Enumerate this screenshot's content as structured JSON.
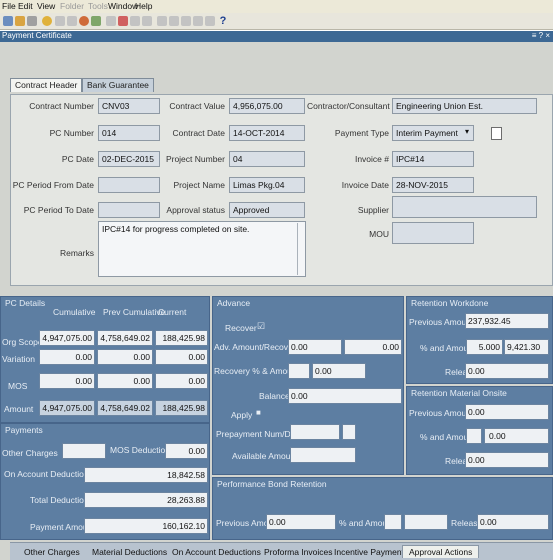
{
  "menu": [
    "File",
    "Edit",
    "View",
    "Folder",
    "Tools",
    "Window",
    "Help"
  ],
  "window": {
    "title": "Payment Certificate",
    "controls": "≡ ? ×"
  },
  "tabs": [
    "Contract Header",
    "Bank Guarantee"
  ],
  "header": {
    "contract_number_label": "Contract Number",
    "contract_number": "CNV03",
    "pc_number_label": "PC Number",
    "pc_number": "014",
    "pc_date_label": "PC Date",
    "pc_date": "02-DEC-2015",
    "pc_period_from_label": "PC Period From Date",
    "pc_period_from": "",
    "pc_period_to_label": "PC Period To Date",
    "pc_period_to": "",
    "contract_value_label": "Contract Value",
    "contract_value": "4,956,075.00",
    "contract_date_label": "Contract Date",
    "contract_date": "14-OCT-2014",
    "project_number_label": "Project Number",
    "project_number": "04",
    "project_name_label": "Project Name",
    "project_name": "Limas Pkg.04",
    "approval_status_label": "Approval status",
    "approval_status": "Approved",
    "contractor_label": "Contractor/Consultant",
    "contractor": "Engineering Union Est.",
    "payment_type_label": "Payment Type",
    "payment_type": "Interim Payment",
    "invoice_no_label": "Invoice #",
    "invoice_no": "IPC#14",
    "invoice_date_label": "Invoice Date",
    "invoice_date": "28-NOV-2015",
    "supplier_label": "Supplier",
    "supplier": "",
    "mou_label": "MOU",
    "mou": "",
    "remarks_label": "Remarks",
    "remarks": "IPC#14 for progress completed on site."
  },
  "pc_details": {
    "title": "PC Details",
    "columns": [
      "Cumulative",
      "Prev Cumulative",
      "Current"
    ],
    "rows": [
      {
        "label": "Org Scope",
        "values": [
          "4,947,075.00",
          "4,758,649.02",
          "188,425.98"
        ]
      },
      {
        "label": "Variation",
        "values": [
          "0.00",
          "0.00",
          "0.00"
        ]
      },
      {
        "label": "MOS",
        "values": [
          "0.00",
          "0.00",
          "0.00"
        ]
      },
      {
        "label": "Amount",
        "values": [
          "4,947,075.00",
          "4,758,649.02",
          "188,425.98"
        ]
      }
    ]
  },
  "payments": {
    "title": "Payments",
    "other_charges_label": "Other Charges",
    "other_charges": "",
    "mos_deduction_label": "MOS Deduction",
    "mos_deduction": "0.00",
    "on_account_deduction_label": "On Account Deduction",
    "on_account_deduction": "18,842.58",
    "total_deductions_label": "Total Deductions",
    "total_deductions": "28,263.88",
    "payment_amount_label": "Payment Amount",
    "payment_amount": "160,162.10"
  },
  "advance": {
    "title": "Advance",
    "recover_label": "Recover",
    "recover_mark": "☑",
    "adv_amount_label": "Adv. Amount/Recovered",
    "adv_amount": "0.00",
    "adv_recovered": "0.00",
    "recovery_pct_label": "Recovery % & Amount",
    "recovery_amount": "0.00",
    "balance_label": "Balance",
    "balance": "0.00",
    "apply_label": "Apply",
    "apply_mark": "■",
    "prepayment_label": "Prepayment Num/Dist",
    "available_label": "Available Amount"
  },
  "performance_bond": {
    "title": "Performance Bond Retention",
    "previous_amount_label": "Previous Amount",
    "previous_amount": "0.00",
    "pct_amount_label": "% and Amount",
    "released_label": "Released",
    "released": "0.00"
  },
  "retention_workdone": {
    "title": "Retention Workdone",
    "previous_amount_label": "Previous Amount",
    "previous_amount": "237,932.45",
    "pct_amount_label": "% and Amount",
    "pct": "5.000",
    "amount": "9,421.30",
    "released_label": "Released",
    "released": "0.00"
  },
  "retention_material": {
    "title": "Retention Material Onsite",
    "previous_amount_label": "Previous Amount",
    "previous_amount": "0.00",
    "pct_amount_label": "% and Amount",
    "amount": "0.00",
    "released_label": "Released",
    "released": "0.00"
  },
  "bottom_tabs": [
    "Other Charges",
    "Material Deductions",
    "On Account Deductions",
    "Proforma Invoices",
    "Incentive Payment",
    "Approval Actions"
  ]
}
